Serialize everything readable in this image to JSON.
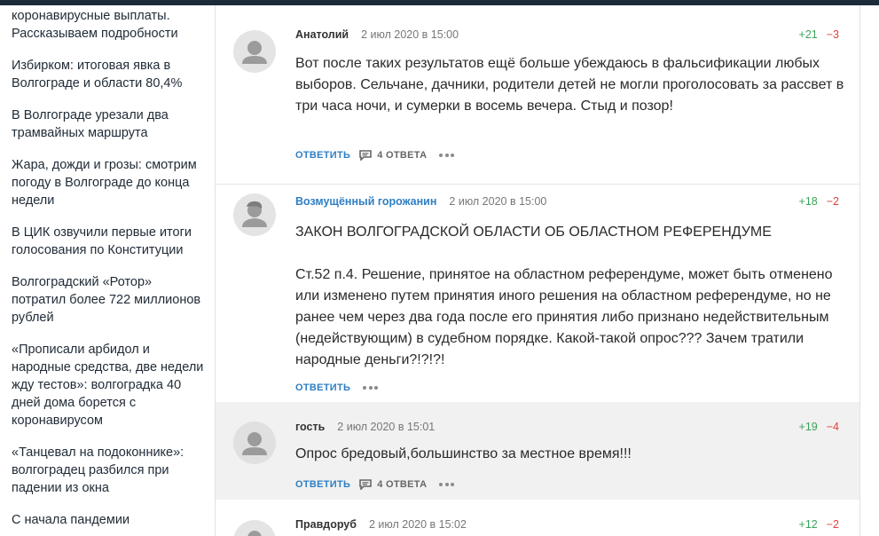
{
  "sidebar": {
    "items": [
      "коронавирусные выплаты. Рассказываем подробности",
      "Избирком: итоговая явка в Волгограде и области 80,4%",
      "В Волгограде урезали два трамвайных маршрута",
      "Жара, дожди и грозы: смотрим погоду в Волгограде до конца недели",
      "В ЦИК озвучили первые итоги голосования по Конституции",
      "Волгоградский «Ротор» потратил более 722 миллионов рублей",
      "«Прописали арбидол и народные средства, две недели жду тестов»: волгоградка 40 дней дома борется с коронавирусом",
      "«Танцевал на подоконнике»: волгоградец разбился при падении из окна",
      "С начала пандемии"
    ]
  },
  "comments": [
    {
      "author": "Анатолий",
      "date": "2 июл 2020 в 15:00",
      "up": "+21",
      "down": "−3",
      "text": "Вот после таких результатов ещё больше убеждаюсь в фальсификации любых выборов. Сельчане, дачники, родители детей не могли проголосовать за рассвет в три часа ночи, и сумерки в восемь вечера. Стыд и позор!",
      "reply_label": "ОТВЕТИТЬ",
      "replies_label": "4 ОТВЕТА"
    },
    {
      "author": "Возмущённый горожанин",
      "date": "2 июл 2020 в 15:00",
      "up": "+18",
      "down": "−2",
      "text_title": "ЗАКОН ВОЛГОГРАДСКОЙ ОБЛАСТИ ОБ ОБЛАСТНОМ РЕФЕРЕНДУМЕ",
      "text": "Ст.52 п.4. Решение, принятое на областном референдуме, может быть отменено или изменено путем принятия иного решения на областном референдуме, но не ранее чем через два года после его принятия либо признано недействительным (недействующим) в судебном порядке. Какой-такой опрос??? Зачем тратили народные деньги?!?!?!",
      "reply_label": "ОТВЕТИТЬ"
    },
    {
      "author": "гость",
      "date": "2 июл 2020 в 15:01",
      "up": "+19",
      "down": "−4",
      "text": "Опрос бредовый,большинство за местное время!!!",
      "reply_label": "ОТВЕТИТЬ",
      "replies_label": "4 ОТВЕТА"
    },
    {
      "author": "Правдоруб",
      "date": "2 июл 2020 в 15:02",
      "up": "+12",
      "down": "−2"
    }
  ]
}
